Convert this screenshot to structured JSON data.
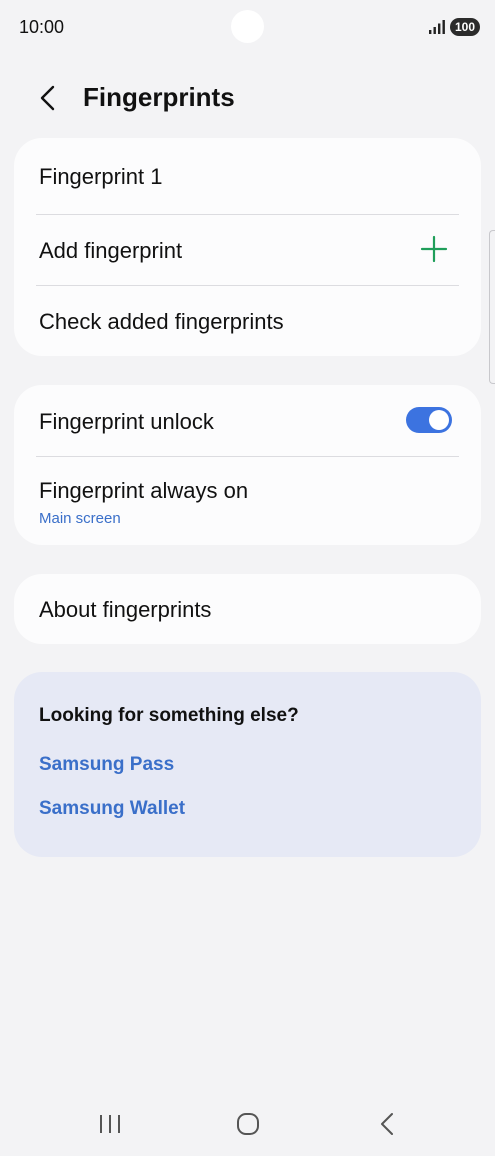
{
  "status": {
    "time": "10:00",
    "battery": "100"
  },
  "header": {
    "title": "Fingerprints"
  },
  "fingerprints_card": {
    "item1": "Fingerprint 1",
    "add": "Add fingerprint",
    "check": "Check added fingerprints"
  },
  "settings_card": {
    "unlock": "Fingerprint unlock",
    "unlock_enabled": true,
    "always_on": "Fingerprint always on",
    "always_on_value": "Main screen"
  },
  "about_card": {
    "label": "About fingerprints"
  },
  "suggestions": {
    "title": "Looking for something else?",
    "links": [
      "Samsung Pass",
      "Samsung Wallet"
    ]
  },
  "colors": {
    "accent": "#3c73e0",
    "link": "#3a6fc9",
    "plus": "#1f9e5a"
  }
}
